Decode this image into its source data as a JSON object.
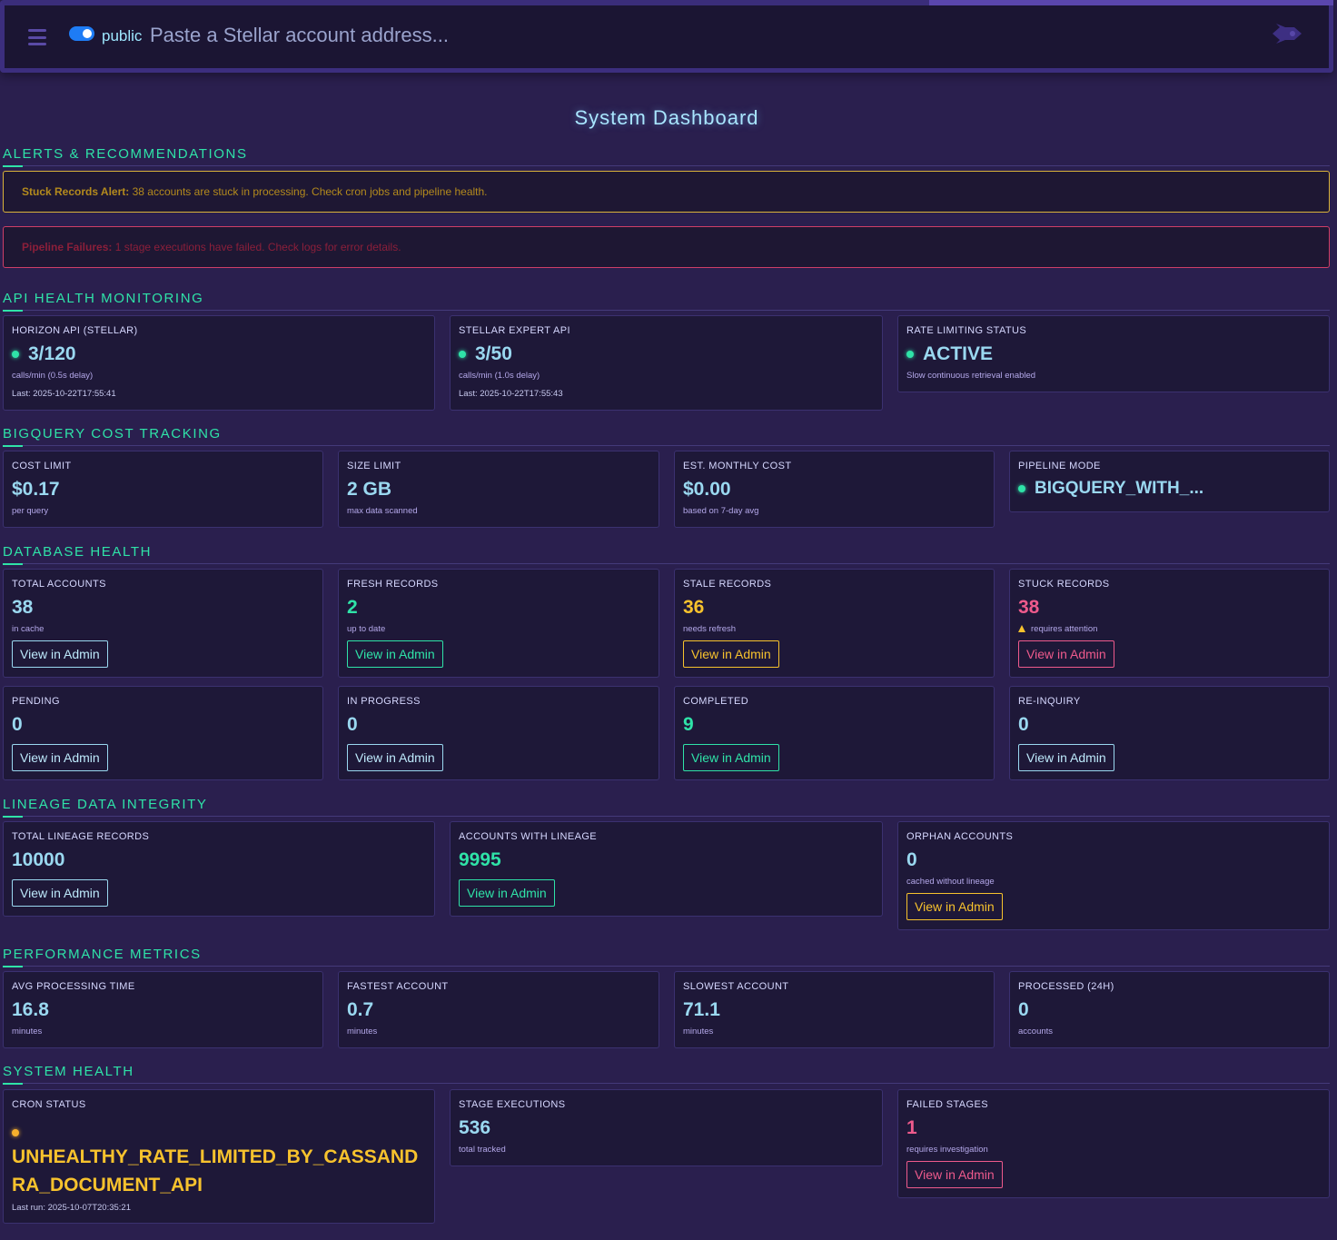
{
  "header": {
    "network_label": "public",
    "search_placeholder": "Paste a Stellar account address..."
  },
  "page_title": "System Dashboard",
  "sections": {
    "alerts": "ALERTS & RECOMMENDATIONS",
    "api": "API HEALTH MONITORING",
    "bigquery": "BIGQUERY COST TRACKING",
    "database": "DATABASE HEALTH",
    "lineage": "LINEAGE DATA INTEGRITY",
    "performance": "PERFORMANCE METRICS",
    "system": "SYSTEM HEALTH"
  },
  "alerts": {
    "stuck": {
      "title": "Stuck Records Alert:",
      "text": " 38 accounts are stuck in processing. Check cron jobs and pipeline health."
    },
    "pipeline": {
      "title": "Pipeline Failures:",
      "text": " 1 stage executions have failed. Check logs for error details."
    }
  },
  "api": {
    "horizon": {
      "label": "HORIZON API (STELLAR)",
      "value": "3/120",
      "sub": "calls/min (0.5s delay)",
      "last": "Last: 2025-10-22T17:55:41"
    },
    "expert": {
      "label": "STELLAR EXPERT API",
      "value": "3/50",
      "sub": "calls/min (1.0s delay)",
      "last": "Last: 2025-10-22T17:55:43"
    },
    "rate": {
      "label": "RATE LIMITING STATUS",
      "value": "ACTIVE",
      "sub": "Slow continuous retrieval enabled"
    }
  },
  "bigquery": {
    "cost_limit": {
      "label": "COST LIMIT",
      "value": "$0.17",
      "sub": "per query"
    },
    "size_limit": {
      "label": "SIZE LIMIT",
      "value": "2 GB",
      "sub": "max data scanned"
    },
    "monthly": {
      "label": "EST. MONTHLY COST",
      "value": "$0.00",
      "sub": "based on 7-day avg"
    },
    "mode": {
      "label": "PIPELINE MODE",
      "value": "BIGQUERY_WITH_..."
    }
  },
  "database": {
    "total": {
      "label": "TOTAL ACCOUNTS",
      "value": "38",
      "sub": "in cache",
      "button": "View in Admin"
    },
    "fresh": {
      "label": "FRESH RECORDS",
      "value": "2",
      "sub": "up to date",
      "button": "View in Admin"
    },
    "stale": {
      "label": "STALE RECORDS",
      "value": "36",
      "sub": "needs refresh",
      "button": "View in Admin"
    },
    "stuck": {
      "label": "STUCK RECORDS",
      "value": "38",
      "sub": "requires attention",
      "button": "View in Admin"
    },
    "pending": {
      "label": "PENDING",
      "value": "0",
      "button": "View in Admin"
    },
    "in_progress": {
      "label": "IN PROGRESS",
      "value": "0",
      "button": "View in Admin"
    },
    "completed": {
      "label": "COMPLETED",
      "value": "9",
      "button": "View in Admin"
    },
    "reinquiry": {
      "label": "RE-INQUIRY",
      "value": "0",
      "button": "View in Admin"
    }
  },
  "lineage": {
    "total": {
      "label": "TOTAL LINEAGE RECORDS",
      "value": "10000",
      "button": "View in Admin"
    },
    "with_lineage": {
      "label": "ACCOUNTS WITH LINEAGE",
      "value": "9995",
      "button": "View in Admin"
    },
    "orphan": {
      "label": "ORPHAN ACCOUNTS",
      "value": "0",
      "sub": "cached without lineage",
      "button": "View in Admin"
    }
  },
  "performance": {
    "avg": {
      "label": "AVG PROCESSING TIME",
      "value": "16.8",
      "sub": "minutes"
    },
    "fastest": {
      "label": "FASTEST ACCOUNT",
      "value": "0.7",
      "sub": "minutes"
    },
    "slowest": {
      "label": "SLOWEST ACCOUNT",
      "value": "71.1",
      "sub": "minutes"
    },
    "processed": {
      "label": "PROCESSED (24H)",
      "value": "0",
      "sub": "accounts"
    }
  },
  "system": {
    "cron": {
      "label": "CRON STATUS",
      "value": "UNHEALTHY_RATE_LIMITED_BY_CASSANDRA_DOCUMENT_API",
      "last": "Last run: 2025-10-07T20:35:21"
    },
    "stages": {
      "label": "STAGE EXECUTIONS",
      "value": "536",
      "sub": "total tracked"
    },
    "failed": {
      "label": "FAILED STAGES",
      "value": "1",
      "sub": "requires investigation",
      "button": "View in Admin"
    }
  },
  "colors": {
    "accent": "#2fe3a8",
    "background": "#2a1f4e",
    "warning": "#f7c22d",
    "danger": "#ee5a8c",
    "info": "#9ad8f0"
  }
}
